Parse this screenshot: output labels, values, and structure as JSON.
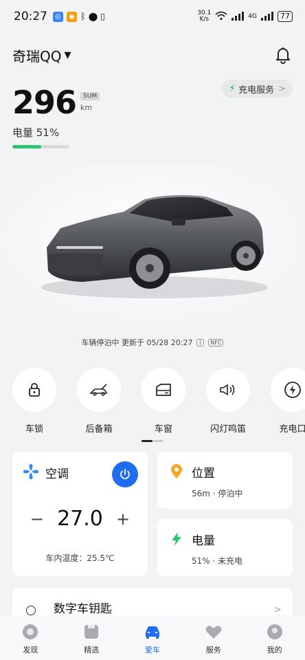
{
  "status_bar": {
    "time": "20:27",
    "net_speed_top": "30.1",
    "net_speed_bottom": "K/s",
    "network": "4G",
    "battery": "77"
  },
  "header": {
    "car_name": "奇瑞QQ",
    "caret": "▼"
  },
  "range": {
    "value": "296",
    "badge": "SUM",
    "unit": "km"
  },
  "charge_service": {
    "label": "充电服务",
    "chevron": ">"
  },
  "soc": {
    "label": "电量 51%",
    "fraction": 0.51,
    "bar_color": "#2ec46d"
  },
  "park_status": {
    "text": "车辆停泊中 更新于 05/28 20:27",
    "nfc": "NFC"
  },
  "controls": [
    {
      "label": "车锁",
      "icon": "lock-icon"
    },
    {
      "label": "后备箱",
      "icon": "trunk-icon"
    },
    {
      "label": "车窗",
      "icon": "window-icon"
    },
    {
      "label": "闪灯鸣笛",
      "icon": "horn-icon"
    },
    {
      "label": "充电口",
      "icon": "charge-port-icon"
    }
  ],
  "ac": {
    "title": "空调",
    "minus": "−",
    "plus": "+",
    "temperature": "27.0",
    "inner_temp": "车内温度：25.5℃",
    "accent": "#1f6ef0"
  },
  "location": {
    "title": "位置",
    "subtitle": "56m · 停泊中",
    "icon_color": "#f5a623"
  },
  "battery": {
    "title": "电量",
    "subtitle": "51% · 未充电",
    "icon_color": "#2ec46d"
  },
  "digital_key": {
    "title": "数字车钥匙",
    "chevron": ">"
  },
  "tabbar": [
    {
      "label": "发现",
      "icon": "discover-icon"
    },
    {
      "label": "精选",
      "icon": "featured-icon"
    },
    {
      "label": "爱车",
      "icon": "car-icon",
      "active": true
    },
    {
      "label": "服务",
      "icon": "service-icon"
    },
    {
      "label": "我的",
      "icon": "profile-icon"
    }
  ]
}
